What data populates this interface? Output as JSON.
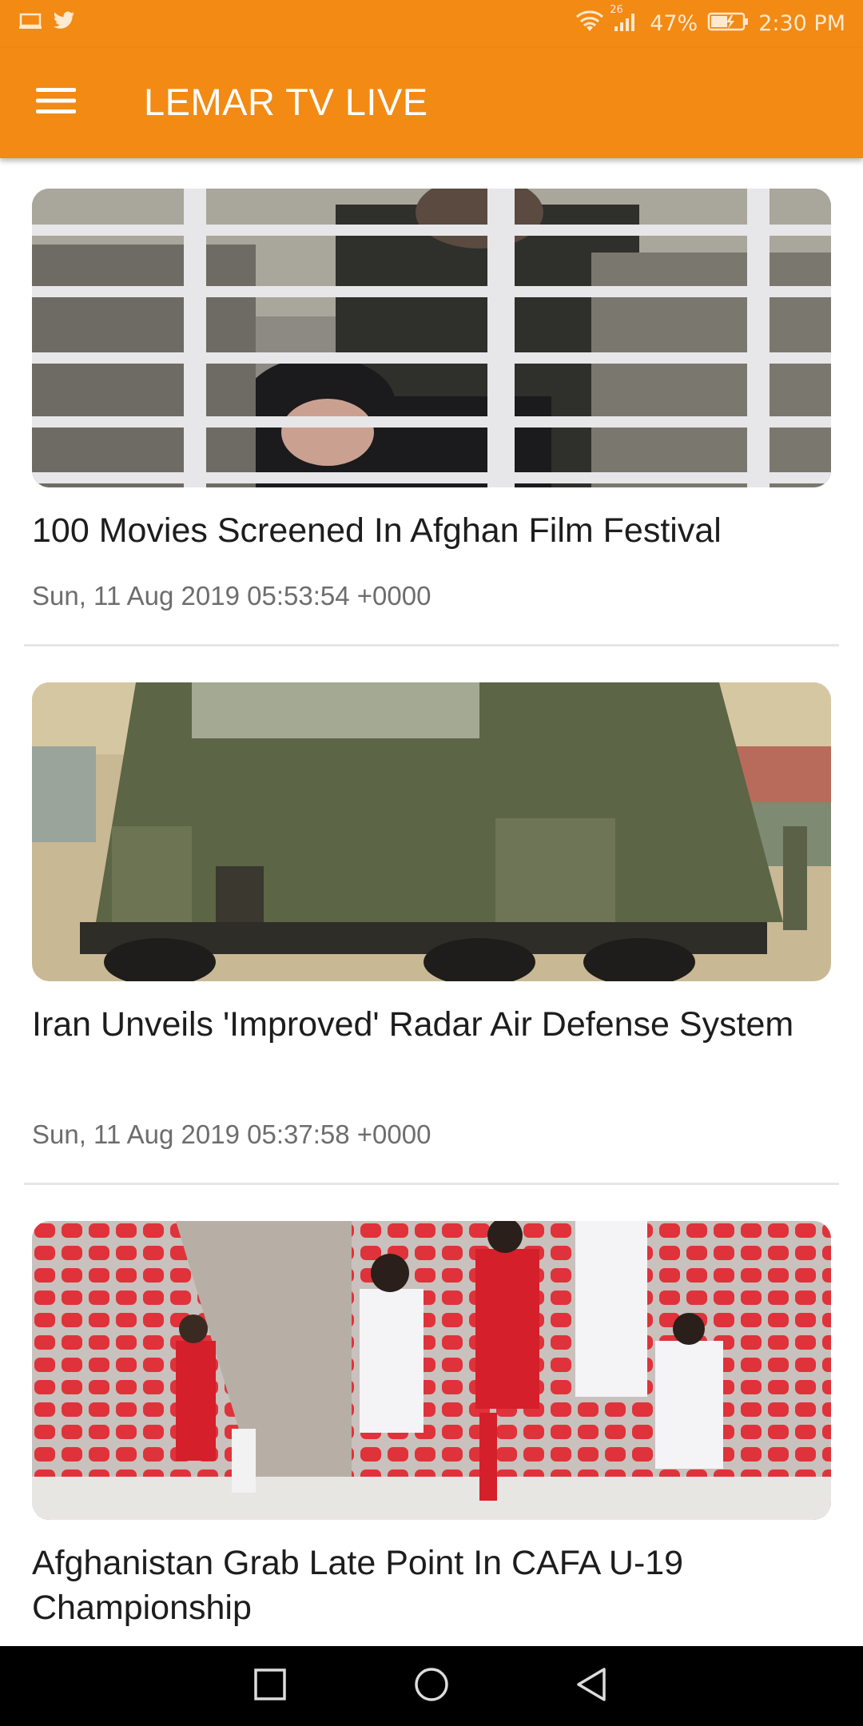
{
  "status_bar": {
    "left_icons": [
      "screen-cast-icon",
      "twitter-icon"
    ],
    "network_label": "26",
    "battery_percent": "47%",
    "time": "2:30 PM"
  },
  "app_bar": {
    "menu_icon": "hamburger-menu-icon",
    "title": "LEMAR TV LIVE",
    "background_color": "#F28A14"
  },
  "articles": [
    {
      "headline": "100 Movies Screened In Afghan Film Festival",
      "date": "Sun, 11 Aug 2019 05:53:54 +0000",
      "image": "film-still-girl-behind-fence"
    },
    {
      "headline": "Iran Unveils 'Improved' Radar Air Defense System",
      "date": "Sun, 11 Aug 2019 05:37:58 +0000",
      "image": "military-radar-truck"
    },
    {
      "headline": "Afghanistan Grab Late Point In CAFA U-19 Championship",
      "date": "",
      "image": "football-match-stadium"
    }
  ],
  "nav_bar": {
    "buttons": [
      "recent-apps-icon",
      "home-icon",
      "back-icon"
    ]
  }
}
